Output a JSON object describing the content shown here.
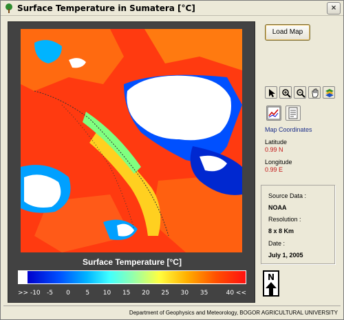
{
  "window": {
    "title": "Surface Temperature in Sumatera [°C]"
  },
  "map": {
    "colorbar_title": "Surface Temperature [°C]",
    "colorbar_ticks": [
      ">> -10",
      "-5",
      "0",
      "5",
      "10",
      "15",
      "20",
      "25",
      "30",
      "35",
      "40 <<"
    ],
    "north_label": "N"
  },
  "controls": {
    "load_map_label": "Load Map",
    "toolbar": [
      "pointer-tool-icon",
      "zoom-in-icon",
      "zoom-out-icon",
      "pan-hand-icon",
      "layers-icon"
    ],
    "map_coordinates_label": "Map Coordinates",
    "latitude_label": "Latitude",
    "latitude_value": "0.99  N",
    "longitude_label": "Longitude",
    "longitude_value": "0.99  E"
  },
  "info": {
    "source_label": "Source Data :",
    "source_value": "NOAA",
    "resolution_label": "Resolution :",
    "resolution_value": "8 x 8 Km",
    "date_label": "Date :",
    "date_value": "July 1, 2005"
  },
  "footer": {
    "text": "Department of Geophysics and Meteorology, BOGOR AGRICULTURAL UNIVERSITY"
  },
  "colors": {
    "panel_bg": "#424242",
    "accent_red": "#c21616",
    "accent_blue": "#1a2e8a"
  }
}
